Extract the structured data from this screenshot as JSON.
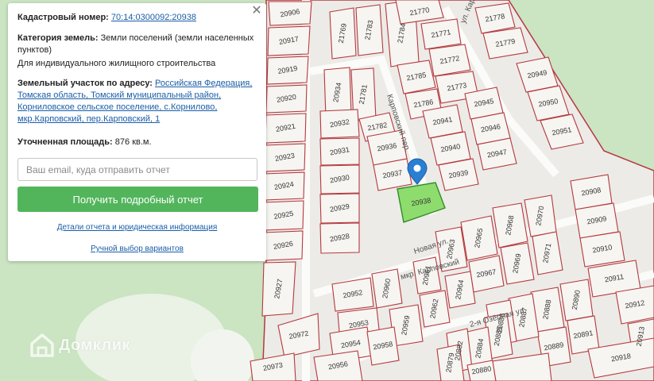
{
  "info_panel": {
    "cadastral_label": "Кадастровый номер:",
    "cadastral_number": "70:14:0300092:20938",
    "category_label": "Категория земель:",
    "category_value": "Земли поселений (земли населенных пунктов)",
    "usage": "Для индивидуального жилищного строительства",
    "address_label": "Земельный участок по адресу:",
    "address_value": "Российская Федерация, Томская область, Томский муниципальный район, Корниловское сельское поселение, с.Корнилово, мкр.Карповский, пер.Карповский, 1",
    "area_label": "Уточненная площадь:",
    "area_value": "876 кв.м.",
    "email_placeholder": "Ваш email, куда отправить отчет",
    "button_label": "Получить подробный отчет",
    "details_link": "Детали отчета и юридическая информация",
    "manual_link": "Ручной выбор вариантов",
    "close_icon": "close-icon"
  },
  "logo": {
    "text": "Домклик",
    "icon": "house-logo-icon"
  },
  "map": {
    "selected_plot": "20938",
    "marker_icon": "location-pin-icon",
    "colors": {
      "boundary": "#b5383f",
      "selected_fill": "#8fdc6e",
      "marker": "#2a7fd4",
      "forest": "#cbe4c2"
    },
    "streets": [
      "Карповский пер.",
      "ул. Карповская",
      "Новая ул.",
      "2-я Озёрная ул.",
      "мкр. Карповский"
    ],
    "plots": [
      "20906",
      "20917",
      "20919",
      "20920",
      "20921",
      "20923",
      "20924",
      "20925",
      "20926",
      "20927",
      "20972",
      "20973",
      "21769",
      "21783",
      "21784",
      "21770",
      "21771",
      "21772",
      "21773",
      "21774",
      "21778",
      "21779",
      "21785",
      "21786",
      "20949",
      "20950",
      "20951",
      "20934",
      "21781",
      "21780",
      "21782",
      "20932",
      "20931",
      "20930",
      "20929",
      "20928",
      "20936",
      "20937",
      "20938",
      "20941",
      "20940",
      "20939",
      "20945",
      "20946",
      "20947",
      "20908",
      "20909",
      "20910",
      "20911",
      "20912",
      "20913",
      "20970",
      "20971",
      "20968",
      "20969",
      "20965",
      "20966",
      "20967",
      "20963",
      "20961",
      "20964",
      "20962",
      "20960",
      "20959",
      "20952",
      "20953",
      "20954",
      "20956",
      "20958",
      "20890",
      "20891",
      "20888",
      "20889",
      "20887",
      "20886",
      "20885",
      "20884",
      "20882",
      "20880",
      "20879",
      "20918"
    ]
  }
}
